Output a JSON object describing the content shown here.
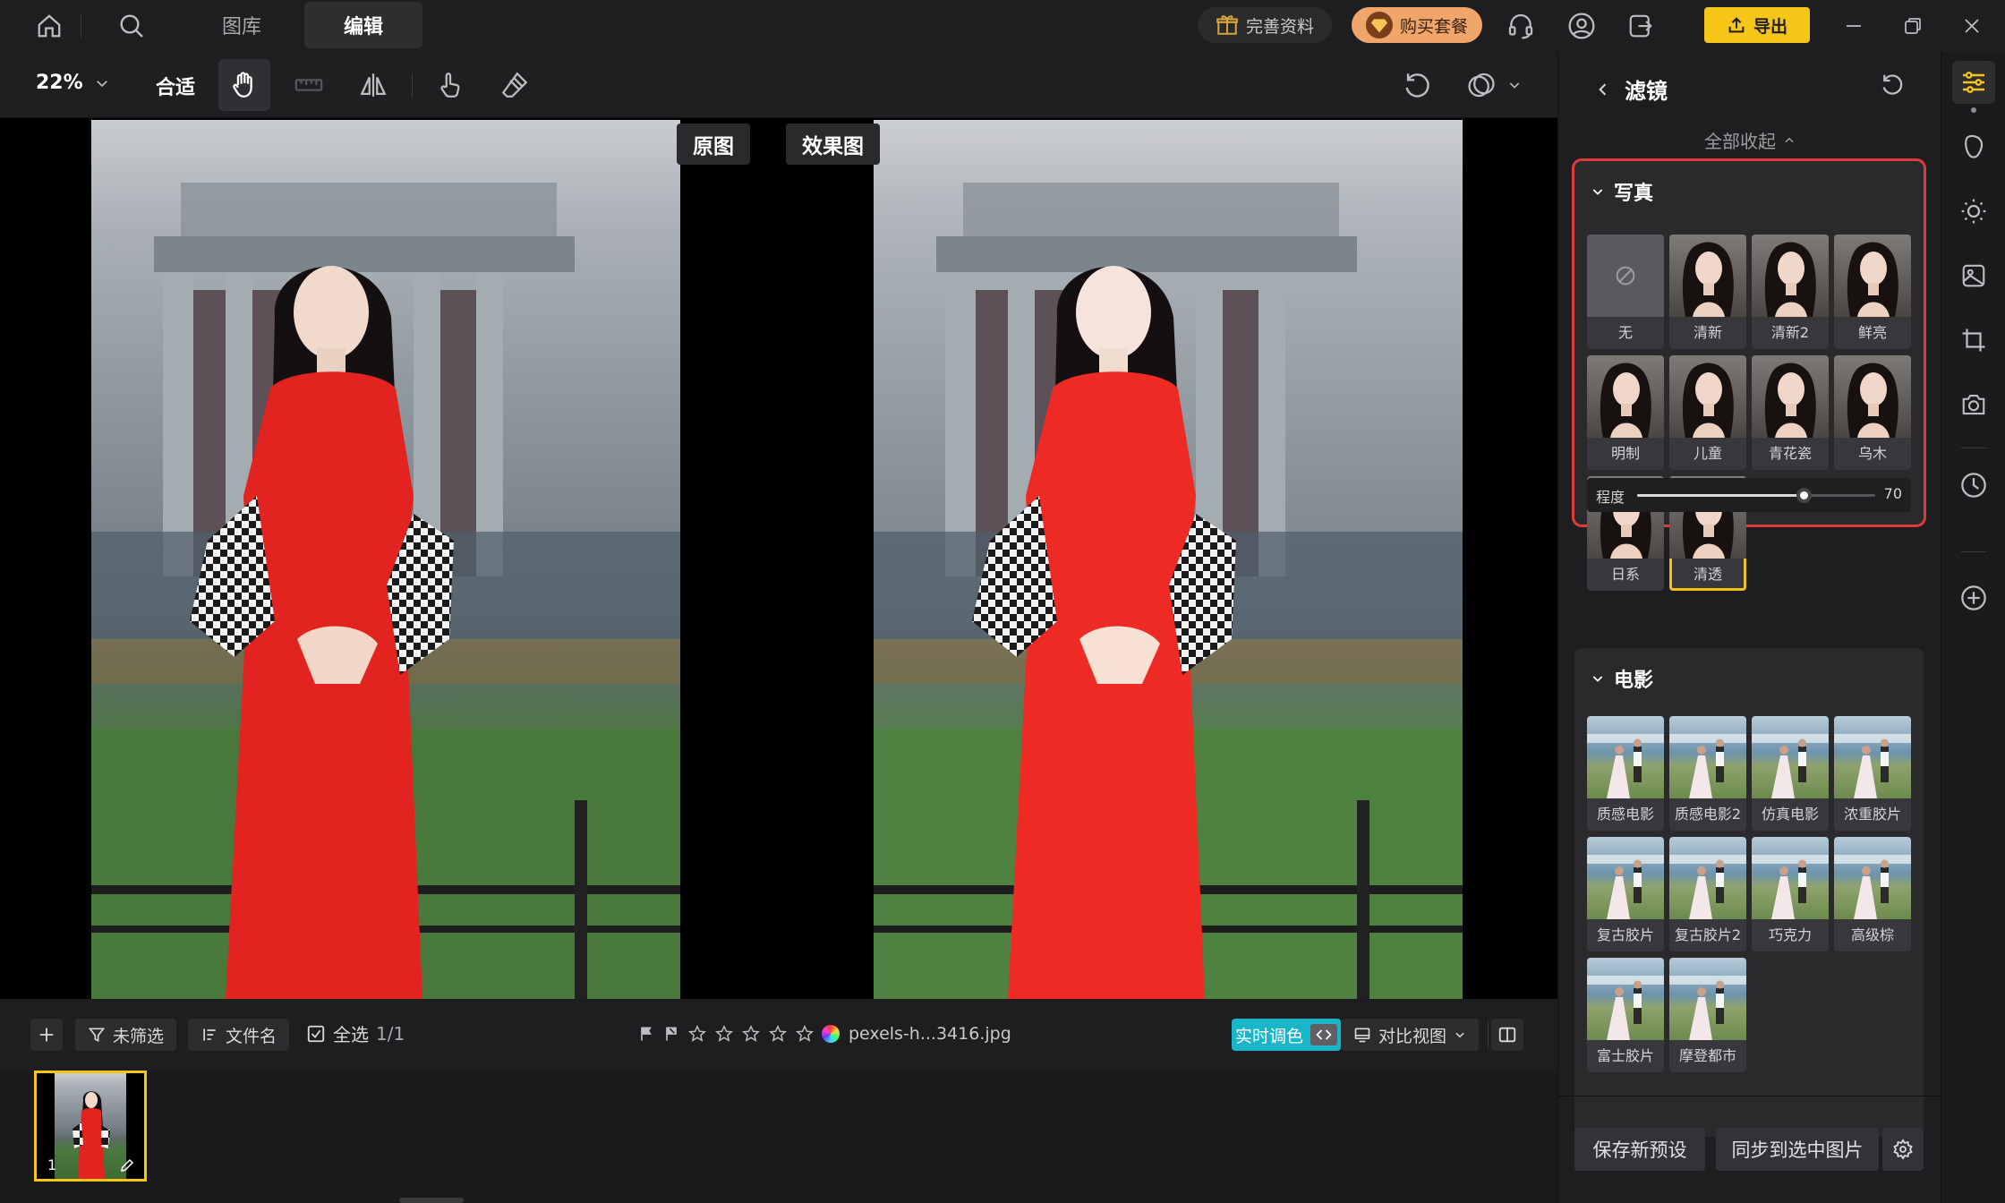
{
  "topbar": {
    "tabs": [
      {
        "label": "图库"
      },
      {
        "label": "编辑"
      }
    ],
    "active_tab": "编辑",
    "profile_label": "完善资料",
    "buy_label": "购买套餐",
    "export_label": "导出"
  },
  "toolbar": {
    "zoom_value": "22%",
    "fit_label": "合适"
  },
  "canvas": {
    "original_label": "原图",
    "effect_label": "效果图"
  },
  "bottombar": {
    "filter_label": "未筛选",
    "sort_label": "文件名",
    "select_all_label": "全选",
    "select_count": "1/1",
    "filename": "pexels-h...3416.jpg",
    "live_label": "实时调色",
    "compare_label": "对比视图"
  },
  "filmstrip": {
    "thumb_index": "1"
  },
  "panel": {
    "title": "滤镜",
    "collapse_all": "全部收起",
    "sections": [
      {
        "title": "写真",
        "filters": [
          {
            "label": "无"
          },
          {
            "label": "清新"
          },
          {
            "label": "清新2"
          },
          {
            "label": "鲜亮"
          },
          {
            "label": "明制"
          },
          {
            "label": "儿童"
          },
          {
            "label": "青花瓷"
          },
          {
            "label": "乌木"
          },
          {
            "label": "日系"
          },
          {
            "label": "清透"
          }
        ],
        "selected_filter": "清透",
        "strength_label": "程度",
        "strength_value": "70",
        "strength_fraction": 0.7
      },
      {
        "title": "电影",
        "filters": [
          {
            "label": "质感电影"
          },
          {
            "label": "质感电影2"
          },
          {
            "label": "仿真电影"
          },
          {
            "label": "浓重胶片"
          },
          {
            "label": "复古胶片"
          },
          {
            "label": "复古胶片2"
          },
          {
            "label": "巧克力"
          },
          {
            "label": "高级棕"
          },
          {
            "label": "富士胶片"
          },
          {
            "label": "摩登都市"
          }
        ]
      }
    ],
    "save_preset_label": "保存新预设",
    "sync_label": "同步到选中图片"
  },
  "colors": {
    "accent_yellow": "#f5c518",
    "live_cyan": "#18b6c8",
    "highlight_red": "#e03a3a",
    "buy_orange": "#f0a56b"
  },
  "icons": [
    "home-icon",
    "search-icon",
    "gift-icon",
    "diamond-icon",
    "headset-icon",
    "user-icon",
    "logout-icon",
    "upload-icon",
    "minimize-icon",
    "restore-icon",
    "close-icon",
    "hand-icon",
    "ruler-icon",
    "flip-icon",
    "touch-icon",
    "eraser-icon",
    "undo-icon",
    "mask-icon",
    "chevron-down-icon",
    "back-icon",
    "reset-icon",
    "adjust-icon",
    "portrait-icon",
    "sun-icon",
    "image-edit-icon",
    "crop-icon",
    "camera-icon",
    "history-icon",
    "add-icon",
    "flag-icon",
    "star-icon",
    "color-wheel-icon",
    "split-view-icon",
    "settings-icon"
  ]
}
